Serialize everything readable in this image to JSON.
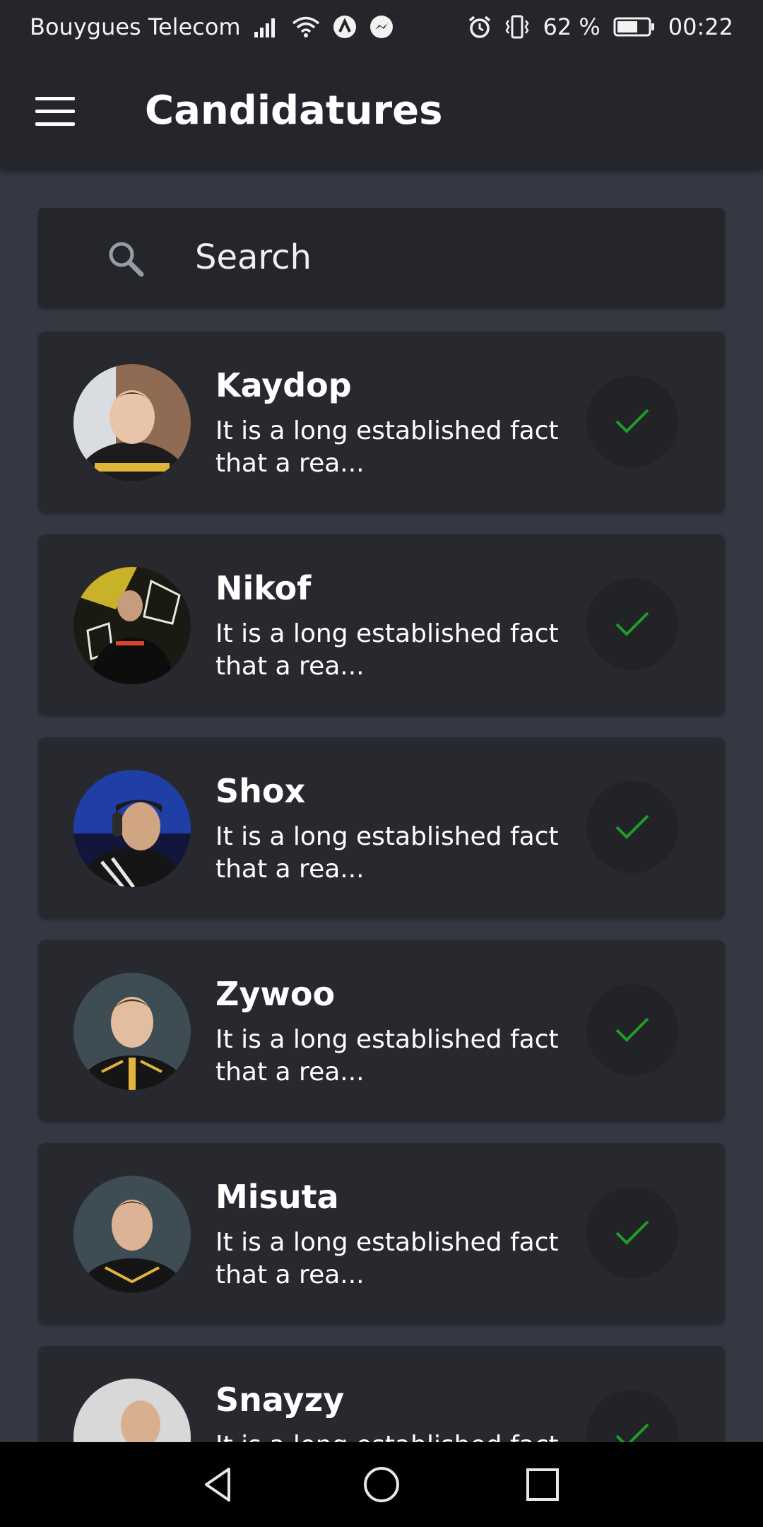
{
  "status_bar": {
    "carrier": "Bouygues Telecom",
    "battery": "62 %",
    "time": "00:22",
    "icons": [
      "signal-icon",
      "wifi-icon",
      "app-notification-icon",
      "messenger-icon",
      "alarm-icon",
      "vibrate-icon",
      "battery-icon"
    ]
  },
  "app_bar": {
    "title": "Candidatures",
    "menu_icon": "hamburger-menu-icon"
  },
  "search": {
    "placeholder": "Search",
    "value": "",
    "icon": "search-icon"
  },
  "candidates": [
    {
      "name": "Kaydop",
      "description": "It is a long established fact that a rea...",
      "action_icon": "check-icon"
    },
    {
      "name": "Nikof",
      "description": "It is a long established fact that a rea...",
      "action_icon": "check-icon"
    },
    {
      "name": "Shox",
      "description": "It is a long established fact that a rea...",
      "action_icon": "check-icon"
    },
    {
      "name": "Zywoo",
      "description": "It is a long established fact that a rea...",
      "action_icon": "check-icon"
    },
    {
      "name": "Misuta",
      "description": "It is a long established fact that a rea...",
      "action_icon": "check-icon"
    },
    {
      "name": "Snayzy",
      "description": "It is a long established fact that a rea...",
      "action_icon": "check-icon"
    }
  ],
  "nav_bar": {
    "buttons": [
      "back-icon",
      "home-icon",
      "recents-icon"
    ]
  },
  "colors": {
    "background": "#353843",
    "bar": "#24262b",
    "card": "#27292f",
    "check": "#1f9b2c"
  }
}
